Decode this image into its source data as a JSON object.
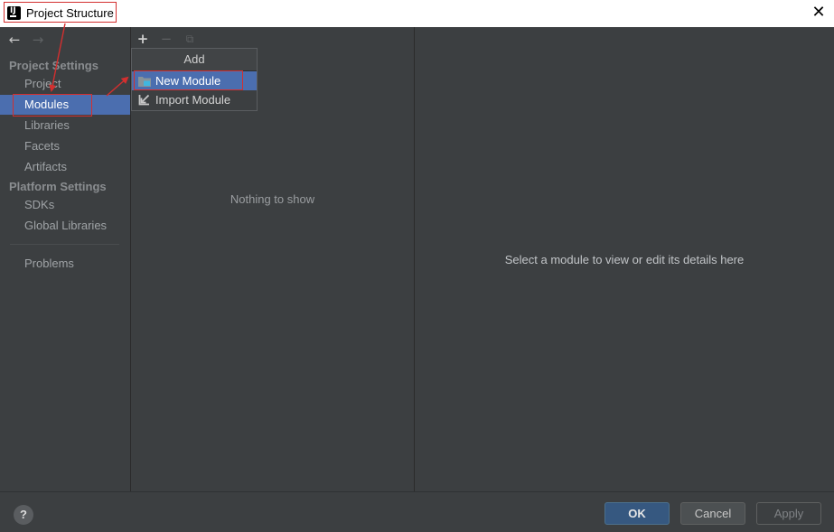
{
  "window": {
    "title": "Project Structure",
    "logo_letter": "IJ",
    "close_glyph": "✕"
  },
  "nav": {
    "back_glyph": "←",
    "forward_glyph": "→"
  },
  "sidebar": {
    "project_settings_header": "Project Settings",
    "platform_settings_header": "Platform Settings",
    "items": [
      {
        "label": "Project"
      },
      {
        "label": "Modules"
      },
      {
        "label": "Libraries"
      },
      {
        "label": "Facets"
      },
      {
        "label": "Artifacts"
      },
      {
        "label": "SDKs"
      },
      {
        "label": "Global Libraries"
      },
      {
        "label": "Problems"
      }
    ]
  },
  "toolbar": {
    "add_glyph": "+",
    "remove_glyph": "−",
    "copy_glyph": "⧉"
  },
  "modules_panel": {
    "empty_text": "Nothing to show"
  },
  "details_panel": {
    "hint": "Select a module to view or edit its details here"
  },
  "add_popup": {
    "header": "Add",
    "items": [
      {
        "label": "New Module",
        "icon": "module-folder-icon"
      },
      {
        "label": "Import Module",
        "icon": "import-arrow-icon"
      }
    ]
  },
  "footer": {
    "help_label": "?",
    "ok_label": "OK",
    "cancel_label": "Cancel",
    "apply_label": "Apply"
  },
  "colors": {
    "background": "#3c3f41",
    "selection": "#4b6eaf",
    "annotation": "#d32f2f",
    "ok_button": "#365880"
  }
}
